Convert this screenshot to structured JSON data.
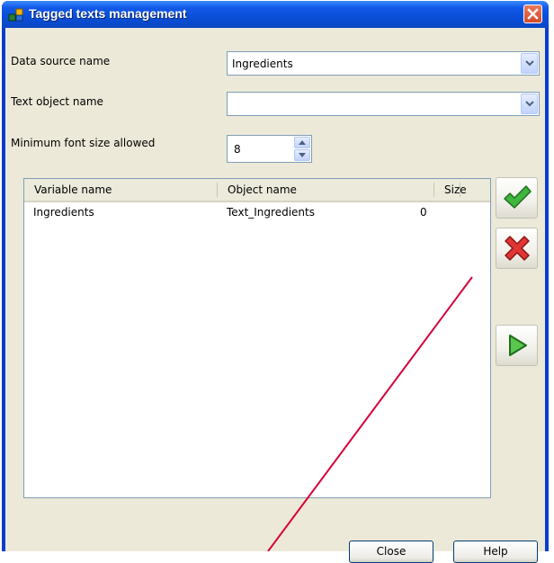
{
  "window": {
    "title": "Tagged texts management"
  },
  "form": {
    "data_source_label": "Data source name",
    "data_source_value": "Ingredients",
    "text_object_label": "Text object name",
    "text_object_value": "",
    "min_font_label": "Minimum font size allowed",
    "min_font_value": "8"
  },
  "table": {
    "columns": [
      "Variable name",
      "Object name",
      "Size"
    ],
    "rows": [
      {
        "variable": "Ingredients",
        "object": "Text_Ingredients",
        "size": "0"
      }
    ]
  },
  "buttons": {
    "close": "Close",
    "help": "Help"
  },
  "icons": {
    "accept": "green-check-icon",
    "delete": "red-x-icon",
    "play": "green-play-icon"
  },
  "colors": {
    "titlebar": "#0a4fd8",
    "client": "#ece9d8",
    "annotation": "#d6003a"
  }
}
